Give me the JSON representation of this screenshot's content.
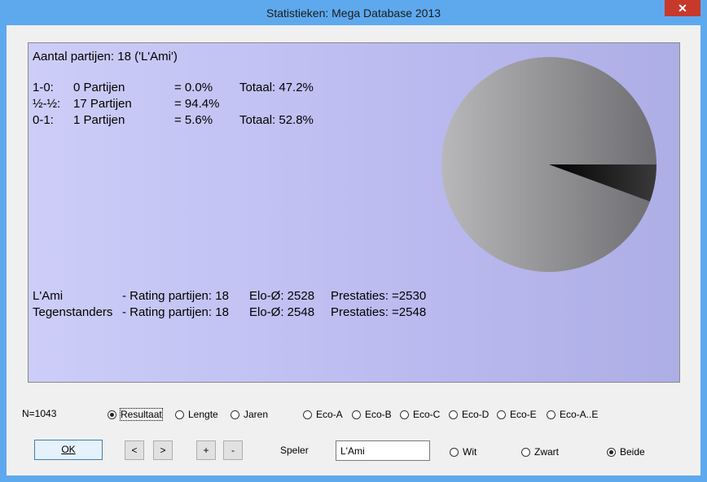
{
  "window": {
    "title": "Statistieken: Mega Database 2013",
    "close_glyph": "✕"
  },
  "stats": {
    "header": "Aantal partijen: 18 ('L'Ami')",
    "results": [
      {
        "label": "1-0:",
        "games": "0 Partijen",
        "pct": "= 0.0%",
        "total": "Totaal: 47.2%"
      },
      {
        "label": "½-½:",
        "games": "17 Partijen",
        "pct": "= 94.4%",
        "total": ""
      },
      {
        "label": "0-1:",
        "games": "1 Partijen",
        "pct": "= 5.6%",
        "total": "Totaal: 52.8%"
      }
    ],
    "ratings": [
      {
        "name": "L'Ami",
        "rating": "- Rating partijen: 18",
        "elo": "Elo-Ø: 2528",
        "perf": "Prestaties: =2530"
      },
      {
        "name": "Tegenstanders",
        "rating": "- Rating partijen: 18",
        "elo": "Elo-Ø: 2548",
        "perf": "Prestaties: =2548"
      }
    ],
    "pie": {
      "draw_fraction": 0.944,
      "loss_fraction": 0.056,
      "colors": {
        "draw": "#9a9a9c",
        "loss": "#111111"
      }
    }
  },
  "footer": {
    "count": "N=1043",
    "modes": [
      {
        "label": "Resultaat",
        "checked": true
      },
      {
        "label": "Lengte",
        "checked": false
      },
      {
        "label": "Jaren",
        "checked": false
      },
      {
        "label": "Eco-A",
        "checked": false
      },
      {
        "label": "Eco-B",
        "checked": false
      },
      {
        "label": "Eco-C",
        "checked": false
      },
      {
        "label": "Eco-D",
        "checked": false
      },
      {
        "label": "Eco-E",
        "checked": false
      },
      {
        "label": "Eco-A..E",
        "checked": false
      }
    ],
    "ok_label": "OK",
    "prev_label": "<",
    "next_label": ">",
    "plus_label": "+",
    "minus_label": "-",
    "player_label": "Speler",
    "player_value": "L'Ami",
    "colors": [
      {
        "label": "Wit",
        "checked": false
      },
      {
        "label": "Zwart",
        "checked": false
      },
      {
        "label": "Beide",
        "checked": true
      }
    ]
  }
}
